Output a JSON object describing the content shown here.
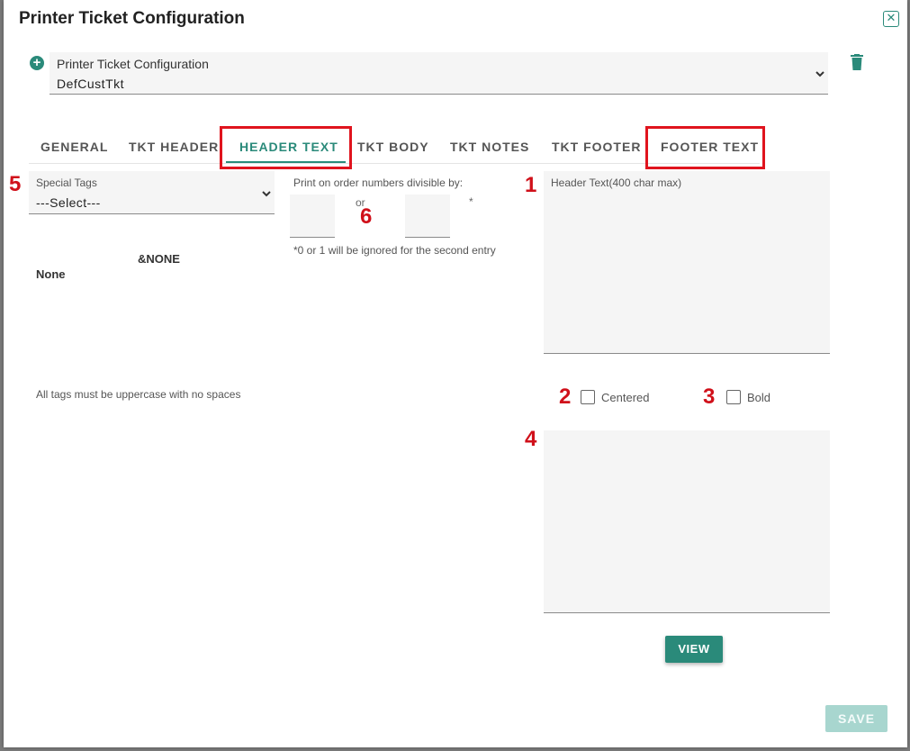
{
  "dialog": {
    "title": "Printer Ticket Configuration"
  },
  "config_select": {
    "label": "Printer Ticket Configuration",
    "value": "DefCustTkt"
  },
  "tabs": [
    {
      "label": "GENERAL",
      "active": false
    },
    {
      "label": "TKT HEADER",
      "active": false
    },
    {
      "label": "HEADER TEXT",
      "active": true
    },
    {
      "label": "TKT BODY",
      "active": false
    },
    {
      "label": "TKT NOTES",
      "active": false
    },
    {
      "label": "TKT FOOTER",
      "active": false
    },
    {
      "label": "FOOTER TEXT",
      "active": false
    }
  ],
  "special_tags": {
    "label": "Special Tags",
    "value": "---Select---",
    "tag_code": "&NONE",
    "tag_name": "None",
    "hint": "All tags must be uppercase with no spaces"
  },
  "print_divisible": {
    "label": "Print on order numbers divisible by:",
    "or_label": "or",
    "asterisk": "*",
    "hint": "*0 or 1 will be ignored for the second entry",
    "first_value": "",
    "second_value": ""
  },
  "header_text": {
    "label": "Header Text(400 char max)"
  },
  "options": {
    "centered_label": "Centered",
    "centered_checked": false,
    "bold_label": "Bold",
    "bold_checked": false
  },
  "markers": {
    "m1": "1",
    "m2": "2",
    "m3": "3",
    "m4": "4",
    "m5": "5",
    "m6": "6"
  },
  "buttons": {
    "view": "VIEW",
    "save": "SAVE"
  },
  "colors": {
    "accent": "#2a8a7a",
    "annotation": "#e0141e",
    "save_disabled": "#a8d6cf"
  },
  "icons": {
    "add": "plus-circle-icon",
    "trash": "trash-icon",
    "close": "close-icon",
    "chevron": "chevron-down-icon"
  }
}
